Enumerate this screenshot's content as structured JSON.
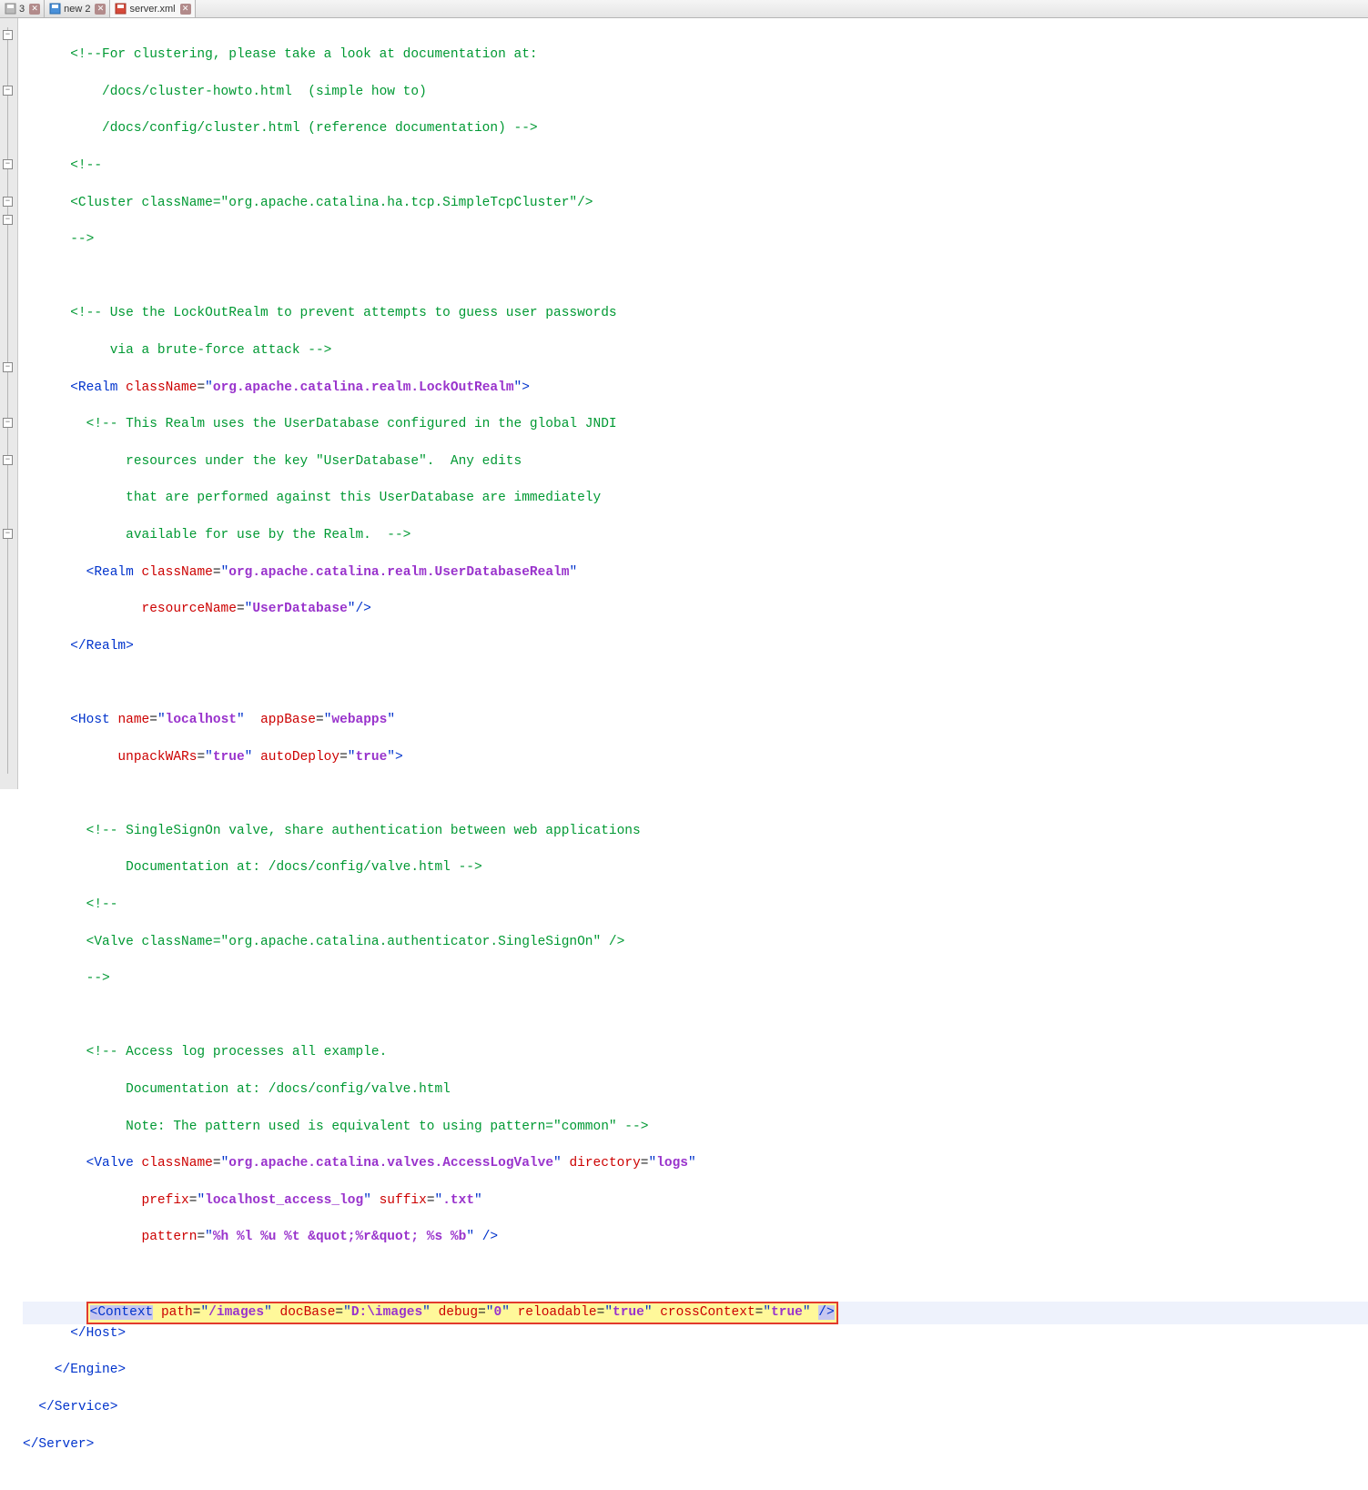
{
  "tabs": [
    {
      "label": "3",
      "icon_color": "#888",
      "close": true,
      "active": false,
      "saved_icon": "disk-gray"
    },
    {
      "label": "new 2",
      "icon_color": "#4a90d9",
      "close": true,
      "active": false,
      "saved_icon": "disk-blue"
    },
    {
      "label": "server.xml",
      "icon_color": "#d64a3a",
      "close": true,
      "active": true,
      "saved_icon": "disk-red"
    }
  ],
  "code": {
    "l1": "      <!--For clustering, please take a look at documentation at:",
    "l2": "          /docs/cluster-howto.html  (simple how to)",
    "l3": "          /docs/config/cluster.html (reference documentation) -->",
    "l4": "      <!--",
    "l5a": "      <Cluster className=\"org.apache.catalina.ha.tcp.SimpleTcpCluster\"/>",
    "l6": "      -->",
    "l7": "",
    "l8": "      <!-- Use the LockOutRealm to prevent attempts to guess user passwords",
    "l9": "           via a brute-force attack -->",
    "l10_tag": "Realm",
    "l10_attr": "className",
    "l10_val": "org.apache.catalina.realm.LockOutRealm",
    "l11": "        <!-- This Realm uses the UserDatabase configured in the global JNDI",
    "l12": "             resources under the key \"UserDatabase\".  Any edits",
    "l13": "             that are performed against this UserDatabase are immediately",
    "l14": "             available for use by the Realm.  -->",
    "l15_tag": "Realm",
    "l15_attr": "className",
    "l15_val": "org.apache.catalina.realm.UserDatabaseRealm",
    "l16_attr": "resourceName",
    "l16_val": "UserDatabase",
    "l17": "      </Realm>",
    "l18": "",
    "l19_tag": "Host",
    "l19_a1": "name",
    "l19_v1": "localhost",
    "l19_a2": "appBase",
    "l19_v2": "webapps",
    "l20_a1": "unpackWARs",
    "l20_v1": "true",
    "l20_a2": "autoDeploy",
    "l20_v2": "true",
    "l21": "",
    "l22": "        <!-- SingleSignOn valve, share authentication between web applications",
    "l23": "             Documentation at: /docs/config/valve.html -->",
    "l24": "        <!--",
    "l25": "        <Valve className=\"org.apache.catalina.authenticator.SingleSignOn\" />",
    "l26": "        -->",
    "l27": "",
    "l28": "        <!-- Access log processes all example.",
    "l29": "             Documentation at: /docs/config/valve.html",
    "l30": "             Note: The pattern used is equivalent to using pattern=\"common\" -->",
    "l31_tag": "Valve",
    "l31_a1": "className",
    "l31_v1": "org.apache.catalina.valves.AccessLogValve",
    "l31_a2": "directory",
    "l31_v2": "logs",
    "l32_a1": "prefix",
    "l32_v1": "localhost_access_log",
    "l32_a2": "suffix",
    "l32_v2": ".txt",
    "l33_a1": "pattern",
    "l33_v1": "%h %l %u %t &quot;%r&quot; %s %b",
    "l34": "",
    "ctx_tag": "Context",
    "ctx_a1": "path",
    "ctx_v1": "/images",
    "ctx_a2": "docBase",
    "ctx_v2": "D:\\images",
    "ctx_a3": "debug",
    "ctx_v3": "0",
    "ctx_a4": "reloadable",
    "ctx_v4": "true",
    "ctx_a5": "crossContext",
    "ctx_v5": "true",
    "l36": "      </Host>",
    "l37": "    </Engine>",
    "l38": "  </Service>",
    "l39": "</Server>"
  }
}
